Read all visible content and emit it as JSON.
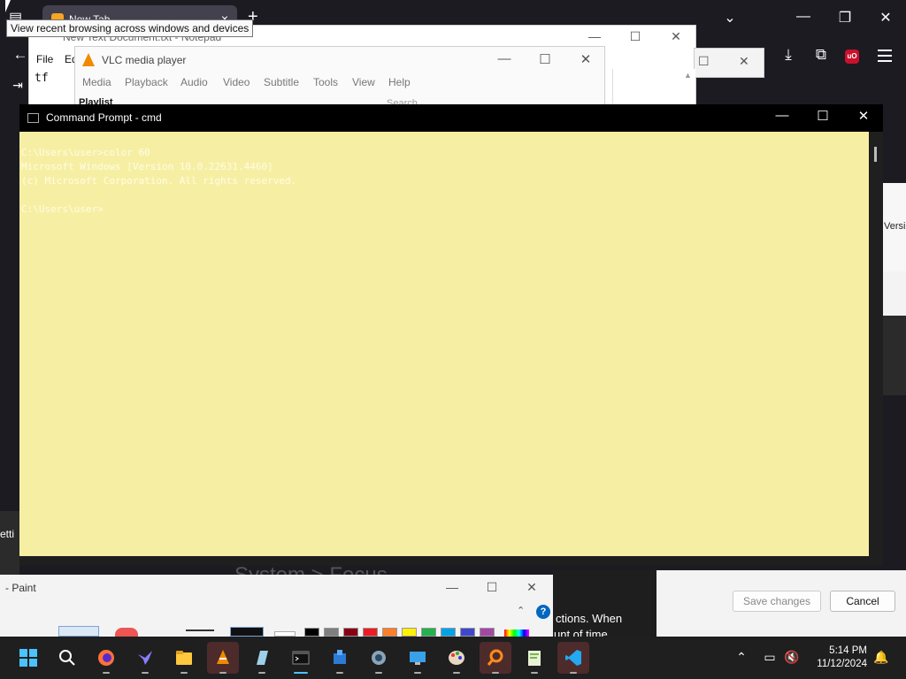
{
  "tooltip": "View recent browsing across windows and devices",
  "browser": {
    "tab_title": "New Tab",
    "tab_close": "×",
    "new_tab": "+",
    "min": "—",
    "max": "❐",
    "close": "✕",
    "tabs_list": "⌄",
    "back": "←",
    "download_icon": "⤓",
    "extensions_icon": "⧉",
    "ublock_label": "uO",
    "side_text_versio": "Versio",
    "side_text_setti": "etti"
  },
  "notepad": {
    "title": "New Text Document.txt - Notepad",
    "menu_file": "File",
    "menu_edit": "Ed",
    "content": "tf",
    "min": "—",
    "max": "☐",
    "close": "✕"
  },
  "vlc": {
    "title": "VLC media player",
    "menu": [
      "Media",
      "Playback",
      "Audio",
      "Video",
      "Subtitle",
      "Tools",
      "View",
      "Help"
    ],
    "playlist_label": "Playlist",
    "search_placeholder": "Search",
    "min": "—",
    "max": "☐",
    "close": "✕"
  },
  "cmd": {
    "title": "Command Prompt - cmd",
    "min": "—",
    "max": "☐",
    "close": "✕",
    "lines": [
      "C:\\Users\\user>color 60",
      "Microsoft Windows [Version 10.0.22631.4460]",
      "(c) Microsoft Corporation. All rights reserved.",
      "",
      "C:\\Users\\user>"
    ]
  },
  "paint": {
    "title": "- Paint",
    "min": "—",
    "max": "☐",
    "close": "✕",
    "help": "?"
  },
  "settings": {
    "section_heading": "System > Focus",
    "description_line1": "ctions. When",
    "description_line2": "unt of time",
    "save_label": "Save changes",
    "cancel_label": "Cancel"
  },
  "taskbar": {
    "time": "5:14 PM",
    "date": "11/12/2024",
    "items": [
      "start",
      "search",
      "firefox",
      "bird-app",
      "file-explorer",
      "vlc",
      "notepad-app",
      "terminal",
      "package-app",
      "settings",
      "remote-desktop",
      "paint",
      "search-tool",
      "notepad-plus",
      "vscode"
    ]
  },
  "colors": {
    "cmd_background": "#f6efa3",
    "cmd_text": "#fffce6",
    "taskbar": "#1f1f1f",
    "browser": "#1c1b22"
  },
  "paint_palette": [
    "#000000",
    "#7f7f7f",
    "#880015",
    "#ed1c24",
    "#ff7f27",
    "#fff200",
    "#22b14c",
    "#00a2e8",
    "#3f48cc",
    "#a349a4"
  ]
}
